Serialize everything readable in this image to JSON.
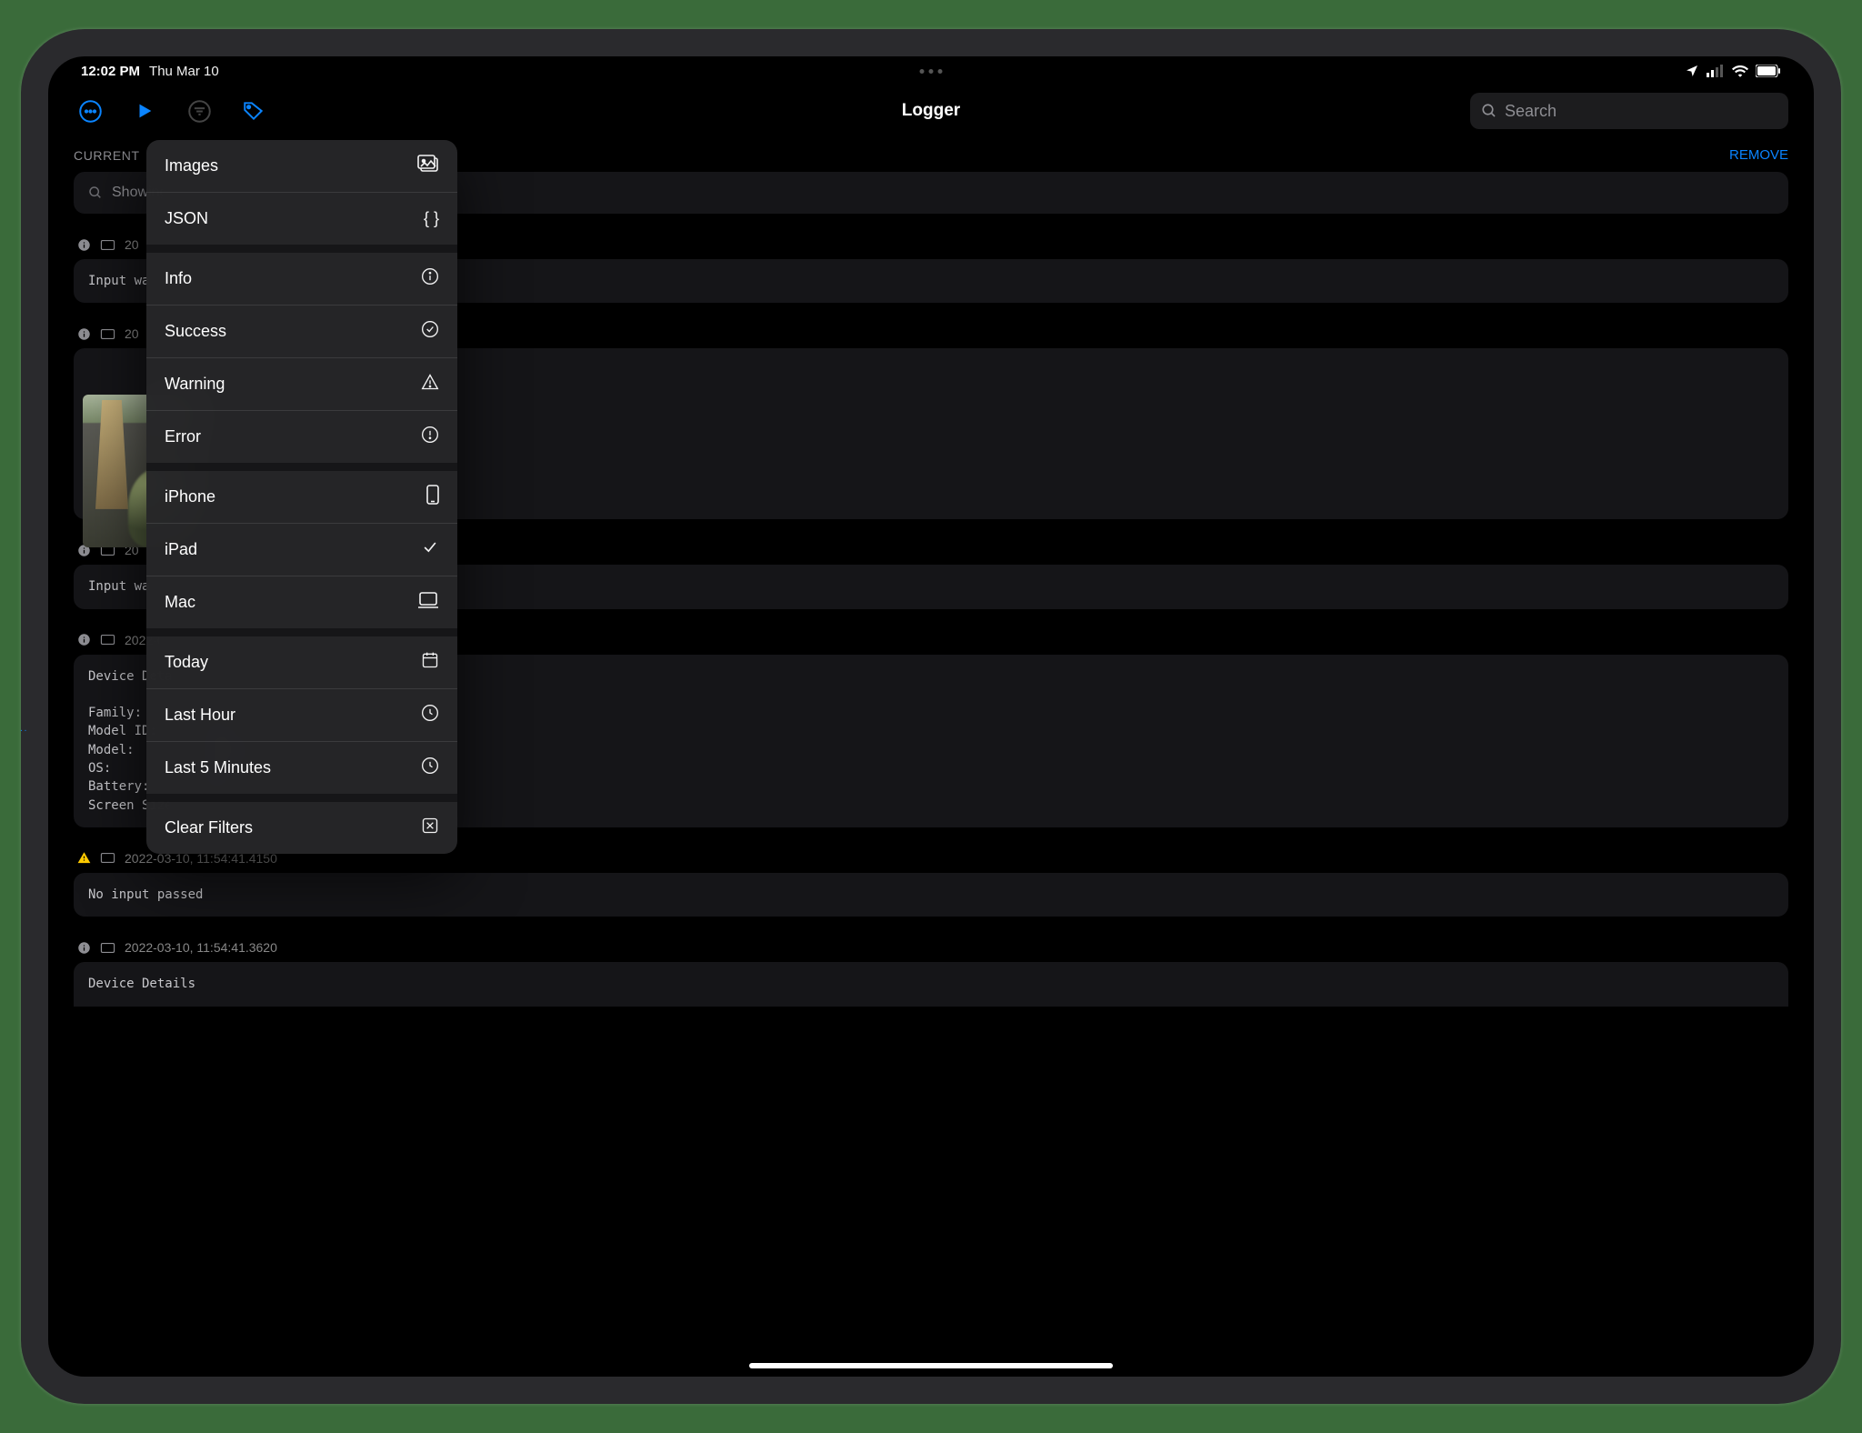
{
  "status": {
    "time": "12:02 PM",
    "date": "Thu Mar 10"
  },
  "toolbar": {
    "title": "Logger",
    "search_placeholder": "Search"
  },
  "filters": {
    "section_label": "CURRENT",
    "remove": "REMOVE",
    "showing_text": "Showing"
  },
  "menu": {
    "images": "Images",
    "json": "JSON",
    "info": "Info",
    "success": "Success",
    "warning": "Warning",
    "error": "Error",
    "iphone": "iPhone",
    "ipad": "iPad",
    "mac": "Mac",
    "today": "Today",
    "last_hour": "Last Hour",
    "last_5": "Last 5 Minutes",
    "clear": "Clear Filters",
    "selected": "ipad"
  },
  "logs": [
    {
      "timestamp": "20",
      "level": "info",
      "body": "Input wa"
    },
    {
      "timestamp": "20",
      "level": "info",
      "body": "",
      "image": true
    },
    {
      "timestamp": "20",
      "level": "info",
      "body": "Input wa"
    },
    {
      "timestamp": "2022-03-10, 11:56:04.0390",
      "level": "info",
      "body": "Device Details\n\nFamily:       iPad\nModel ID:     iPad13,11\nModel:        iPad Pro 12.9 inch 5th Gen\nOS:           iPadOS 15.4.0\nBattery:      89%\nScreen Size:  2732x2048"
    },
    {
      "timestamp": "2022-03-10, 11:54:41.4150",
      "level": "warning",
      "body": "No input passed"
    },
    {
      "timestamp": "2022-03-10, 11:54:41.3620",
      "level": "info",
      "body": "Device Details"
    }
  ]
}
